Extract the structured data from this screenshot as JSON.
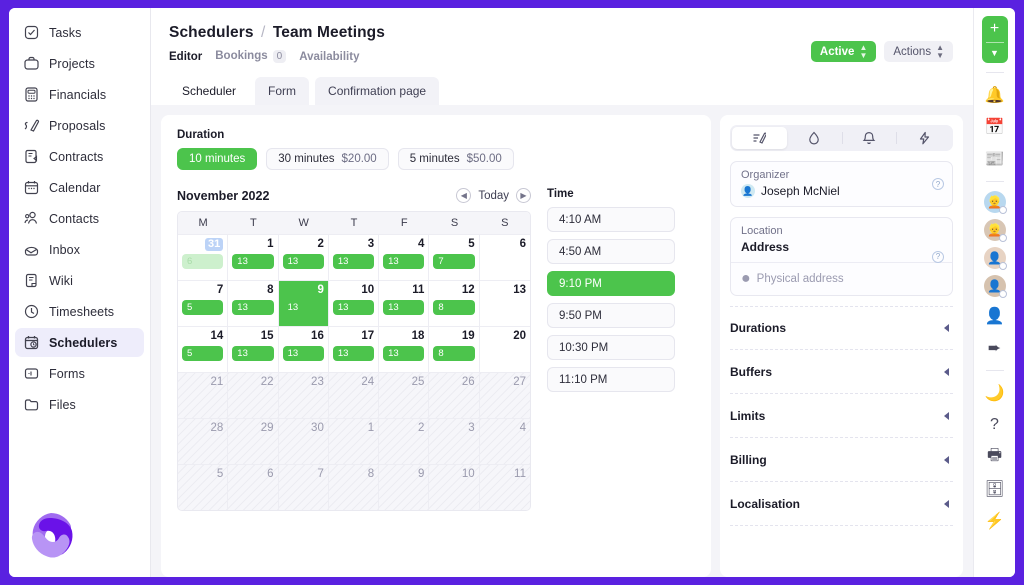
{
  "sidebar": {
    "items": [
      {
        "label": "Tasks",
        "icon": "check-square-icon"
      },
      {
        "label": "Projects",
        "icon": "briefcase-icon"
      },
      {
        "label": "Financials",
        "icon": "calculator-icon"
      },
      {
        "label": "Proposals",
        "icon": "pen-icon"
      },
      {
        "label": "Contracts",
        "icon": "contract-icon"
      },
      {
        "label": "Calendar",
        "icon": "calendar-icon"
      },
      {
        "label": "Contacts",
        "icon": "contacts-icon"
      },
      {
        "label": "Inbox",
        "icon": "inbox-icon"
      },
      {
        "label": "Wiki",
        "icon": "book-icon"
      },
      {
        "label": "Timesheets",
        "icon": "clock-icon"
      },
      {
        "label": "Schedulers",
        "icon": "scheduler-icon",
        "active": true
      },
      {
        "label": "Forms",
        "icon": "form-icon"
      },
      {
        "label": "Files",
        "icon": "folder-icon"
      }
    ],
    "logo_name": "app-logo"
  },
  "header": {
    "breadcrumb_root": "Schedulers",
    "breadcrumb_sep": "/",
    "breadcrumb_current": "Team Meetings",
    "subtabs": [
      {
        "label": "Editor",
        "active": true
      },
      {
        "label": "Bookings",
        "count": "0"
      },
      {
        "label": "Availability"
      }
    ],
    "status_label": "Active",
    "actions_label": "Actions"
  },
  "tabs": [
    {
      "label": "Scheduler",
      "active": true
    },
    {
      "label": "Form"
    },
    {
      "label": "Confirmation page"
    }
  ],
  "duration": {
    "title": "Duration",
    "options": [
      {
        "label": "10 minutes",
        "price": "",
        "active": true
      },
      {
        "label": "30 minutes",
        "price": "$20.00"
      },
      {
        "label": "5 minutes",
        "price": "$50.00"
      }
    ]
  },
  "calendar": {
    "month": "November 2022",
    "today_label": "Today",
    "prev_icon": "chevron-left-icon",
    "next_icon": "chevron-right-icon",
    "dow": [
      "M",
      "T",
      "W",
      "T",
      "F",
      "S",
      "S"
    ],
    "weeks": [
      [
        {
          "num": "31",
          "today": true,
          "chip": "6",
          "faded": true
        },
        {
          "num": "1",
          "chip": "13"
        },
        {
          "num": "2",
          "chip": "13"
        },
        {
          "num": "3",
          "chip": "13"
        },
        {
          "num": "4",
          "chip": "13"
        },
        {
          "num": "5",
          "chip": "7"
        },
        {
          "num": "6"
        }
      ],
      [
        {
          "num": "7",
          "chip": "5"
        },
        {
          "num": "8",
          "chip": "13"
        },
        {
          "num": "9",
          "chip": "13",
          "selected": true
        },
        {
          "num": "10",
          "chip": "13"
        },
        {
          "num": "11",
          "chip": "13"
        },
        {
          "num": "12",
          "chip": "8"
        },
        {
          "num": "13"
        }
      ],
      [
        {
          "num": "14",
          "chip": "5"
        },
        {
          "num": "15",
          "chip": "13"
        },
        {
          "num": "16",
          "chip": "13"
        },
        {
          "num": "17",
          "chip": "13"
        },
        {
          "num": "18",
          "chip": "13"
        },
        {
          "num": "19",
          "chip": "8"
        },
        {
          "num": "20"
        }
      ],
      [
        {
          "num": "21",
          "off": true
        },
        {
          "num": "22",
          "off": true
        },
        {
          "num": "23",
          "off": true
        },
        {
          "num": "24",
          "off": true
        },
        {
          "num": "25",
          "off": true
        },
        {
          "num": "26",
          "off": true
        },
        {
          "num": "27",
          "off": true
        }
      ],
      [
        {
          "num": "28",
          "off": true
        },
        {
          "num": "29",
          "off": true
        },
        {
          "num": "30",
          "off": true
        },
        {
          "num": "1",
          "off": true
        },
        {
          "num": "2",
          "off": true
        },
        {
          "num": "3",
          "off": true
        },
        {
          "num": "4",
          "off": true
        }
      ],
      [
        {
          "num": "5",
          "off": true
        },
        {
          "num": "6",
          "off": true
        },
        {
          "num": "7",
          "off": true
        },
        {
          "num": "8",
          "off": true
        },
        {
          "num": "9",
          "off": true
        },
        {
          "num": "10",
          "off": true
        },
        {
          "num": "11",
          "off": true
        }
      ]
    ]
  },
  "time": {
    "title": "Time",
    "slots": [
      {
        "label": "4:10 AM"
      },
      {
        "label": "4:50 AM"
      },
      {
        "label": "9:10 PM",
        "active": true
      },
      {
        "label": "9:50 PM"
      },
      {
        "label": "10:30 PM"
      },
      {
        "label": "11:10 PM"
      }
    ]
  },
  "right_panel": {
    "icon_tabs": [
      {
        "icon": "edit-pen-icon",
        "active": true
      },
      {
        "icon": "droplet-icon"
      },
      {
        "icon": "bell-icon"
      },
      {
        "icon": "lightning-icon"
      }
    ],
    "organizer": {
      "label": "Organizer",
      "name": "Joseph McNiel",
      "avatar_icon": "avatar",
      "help_icon": "help-icon"
    },
    "location": {
      "label": "Location",
      "value": "Address",
      "placeholder": "Physical address",
      "pin_icon": "map-pin-icon",
      "help_icon": "help-icon"
    },
    "sections": [
      {
        "label": "Durations"
      },
      {
        "label": "Buffers"
      },
      {
        "label": "Limits"
      },
      {
        "label": "Billing"
      },
      {
        "label": "Localisation"
      }
    ]
  },
  "rail": {
    "add_label": "+",
    "chev_label": "⌄",
    "icons": [
      {
        "icon": "bell-icon"
      },
      {
        "icon": "calendar-31-icon"
      },
      {
        "icon": "news-icon"
      }
    ],
    "avatars": [
      {
        "icon": "avatar-1"
      },
      {
        "icon": "avatar-2"
      },
      {
        "icon": "avatar-3"
      },
      {
        "icon": "avatar-4"
      }
    ],
    "tools": [
      {
        "icon": "add-person-icon"
      },
      {
        "icon": "send-icon"
      }
    ],
    "bottom_icons": [
      {
        "icon": "moon-icon"
      },
      {
        "icon": "help-circle-icon"
      },
      {
        "icon": "printer-icon"
      },
      {
        "icon": "archive-icon"
      },
      {
        "icon": "lightning-icon"
      }
    ]
  },
  "colors": {
    "accent_purple": "#5a21e0",
    "green": "#4cc44c",
    "today_blue": "#bcd3f7"
  }
}
